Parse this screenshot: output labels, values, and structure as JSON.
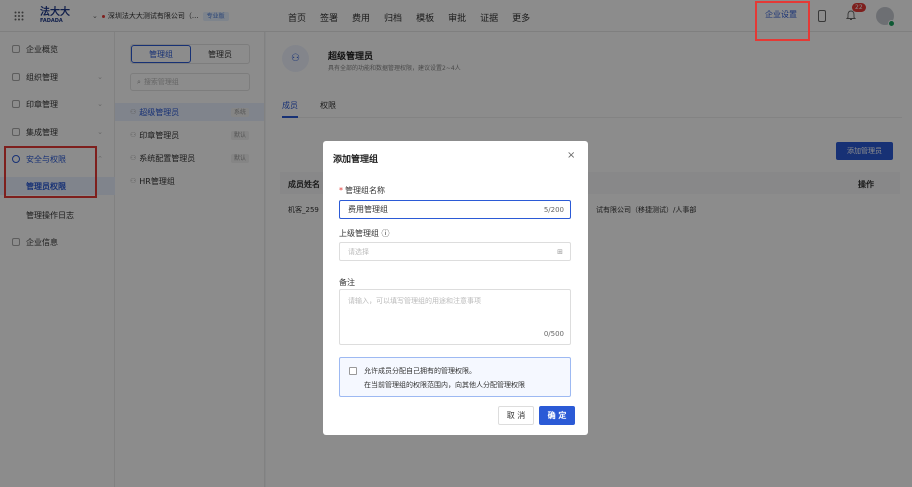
{
  "topbar": {
    "logo_cn": "法大大",
    "logo_en": "FADADA",
    "company": "深圳法大大测试有限公司（...",
    "version_badge": "专业版",
    "nav": [
      "首页",
      "签署",
      "费用",
      "归档",
      "模板",
      "审批",
      "证据",
      "更多"
    ],
    "enterprise_settings": "企业设置",
    "notification_count": "22",
    "icons": {
      "grid": "grid-icon",
      "phone": "phone-icon",
      "bell": "bell-icon",
      "avatar": "avatar"
    }
  },
  "sidebar": {
    "items": [
      {
        "label": "企业概览"
      },
      {
        "label": "组织管理"
      },
      {
        "label": "印章管理"
      },
      {
        "label": "集成管理"
      },
      {
        "label": "安全与权限"
      }
    ],
    "sub_items": [
      {
        "label": "管理员权限"
      },
      {
        "label": "管理操作日志"
      }
    ],
    "info_item": {
      "label": "企业信息"
    }
  },
  "groups": {
    "segment": [
      "管理组",
      "管理员"
    ],
    "search_placeholder": "搜索管理组",
    "rows": [
      {
        "label": "超级管理员",
        "tag": "系统"
      },
      {
        "label": "印章管理员",
        "tag": "默认"
      },
      {
        "label": "系统配置管理员",
        "tag": "默认"
      },
      {
        "label": "HR管理组",
        "tag": ""
      }
    ]
  },
  "main": {
    "role_icon": "group-icon",
    "role_title": "超级管理员",
    "role_desc": "具有全部的功能和数据管理权限，建议设置2~4人",
    "tabs": [
      "成员",
      "权限"
    ],
    "add_member": "添加管理员",
    "columns": {
      "name": "成员姓名",
      "action": "操作"
    },
    "row": {
      "name": "机客_259",
      "dept": "试有限公司（移捷测试）/人事部"
    }
  },
  "dialog": {
    "title": "添加管理组",
    "close": "×",
    "name_label": "管理组名称",
    "name_value": "费用管理组",
    "name_count": "5/200",
    "parent_label": "上级管理组 ⓘ",
    "parent_placeholder": "请选择",
    "remark_label": "备注",
    "remark_placeholder": "请输入，可以填写管理组的用途和注意事项",
    "remark_count": "0/500",
    "checkbox_line1": "允许成员分配自己拥有的管理权限。",
    "checkbox_line2": "在当前管理组的权限范围内，向其他人分配管理权限",
    "cancel": "取 消",
    "confirm": "确 定"
  }
}
